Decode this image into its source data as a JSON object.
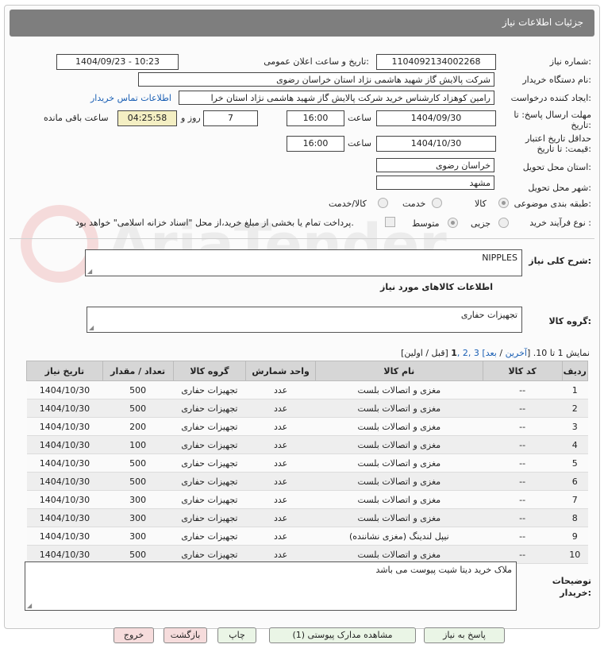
{
  "header": {
    "title": "جزئیات اطلاعات نیاز"
  },
  "fields": {
    "need_number_label": "شماره نیاز:",
    "need_number": "1104092134002268",
    "announce_label": "تاریخ و ساعت اعلان عمومی:",
    "announce_value": "1404/09/23 - 10:23",
    "buyer_org_label": "نام دستگاه خریدار:",
    "buyer_org": "شرکت پالایش گاز شهید هاشمی نژاد   استان خراسان رضوی",
    "requester_label": "ایجاد کننده درخواست:",
    "requester": "رامین کوهزاد کارشناس خرید شرکت پالایش گاز شهید هاشمی نژاد   استان خرا",
    "contact_link": "اطلاعات تماس خریدار",
    "deadline_label_1": "مهلت ارسال پاسخ: تا",
    "deadline_label_2": "تاریخ:",
    "deadline_date": "1404/09/30",
    "time_label": "ساعت",
    "deadline_time": "16:00",
    "days_value": "7",
    "days_label": "روز و",
    "remaining_time": "04:25:58",
    "remaining_label": "ساعت باقی مانده",
    "validity_label_1": "حداقل تاریخ اعتبار",
    "validity_label_2": "قیمت: تا تاریخ:",
    "validity_date": "1404/10/30",
    "validity_time": "16:00",
    "province_label": "استان محل تحویل:",
    "province": "خراسان رضوی",
    "city_label": "شهر محل تحویل:",
    "city": "مشهد",
    "category_label": "طبقه بندی موضوعی:",
    "category_options": [
      "کالا",
      "خدمت",
      "کالا/خدمت"
    ],
    "category_selected": "کالا",
    "process_label": "نوع فرآیند خرید :",
    "process_options": [
      "جزیی",
      "متوسط"
    ],
    "process_selected": "جزیی",
    "payment_note": "پرداخت تمام یا بخشی از مبلغ خرید،از محل \"اسناد خزانه اسلامی\" خواهد بود."
  },
  "description": {
    "label": "شرح کلی نیاز:",
    "value": "NIPPLES"
  },
  "goods_section": {
    "title": "اطلاعات کالاهای مورد نیاز",
    "group_label": "گروه کالا:",
    "group_value": "تجهیزات حفاری"
  },
  "pagination": {
    "prefix": "نمایش 1 تا 10. [",
    "last": "آخرین",
    "slash1": " / ",
    "next": "بعد",
    "pages": "] 3 ,2 ,",
    "current": "1",
    "suffix": " [قبل / اولین]"
  },
  "table": {
    "headers": [
      "ردیف",
      "کد کالا",
      "نام کالا",
      "واحد شمارش",
      "گروه کالا",
      "تعداد / مقدار",
      "تاریخ نیاز"
    ],
    "rows": [
      [
        "1",
        "--",
        "مغزی و اتصالات بلست",
        "عدد",
        "تجهیزات حفاری",
        "500",
        "1404/10/30"
      ],
      [
        "2",
        "--",
        "مغزی و اتصالات بلست",
        "عدد",
        "تجهیزات حفاری",
        "500",
        "1404/10/30"
      ],
      [
        "3",
        "--",
        "مغزی و اتصالات بلست",
        "عدد",
        "تجهیزات حفاری",
        "200",
        "1404/10/30"
      ],
      [
        "4",
        "--",
        "مغزی و اتصالات بلست",
        "عدد",
        "تجهیزات حفاری",
        "100",
        "1404/10/30"
      ],
      [
        "5",
        "--",
        "مغزی و اتصالات بلست",
        "عدد",
        "تجهیزات حفاری",
        "500",
        "1404/10/30"
      ],
      [
        "6",
        "--",
        "مغزی و اتصالات بلست",
        "عدد",
        "تجهیزات حفاری",
        "500",
        "1404/10/30"
      ],
      [
        "7",
        "--",
        "مغزی و اتصالات بلست",
        "عدد",
        "تجهیزات حفاری",
        "300",
        "1404/10/30"
      ],
      [
        "8",
        "--",
        "مغزی و اتصالات بلست",
        "عدد",
        "تجهیزات حفاری",
        "300",
        "1404/10/30"
      ],
      [
        "9",
        "--",
        "نیپل لندینگ (مغزی نشاننده)",
        "عدد",
        "تجهیزات حفاری",
        "300",
        "1404/10/30"
      ],
      [
        "10",
        "--",
        "مغزی و اتصالات بلست",
        "عدد",
        "تجهیزات حفاری",
        "500",
        "1404/10/30"
      ]
    ]
  },
  "buyer_notes": {
    "label_1": "توضیحات",
    "label_2": "خریدار:",
    "value": "ملاک خرید دیتا شیت پیوست می باشد"
  },
  "buttons": {
    "reply": "پاسخ به نیاز",
    "attachments": "مشاهده مدارک پیوستی (1)",
    "print": "چاپ",
    "back": "بازگشت",
    "exit": "خروج"
  },
  "watermark": {
    "text": "AriaTender.neT"
  }
}
